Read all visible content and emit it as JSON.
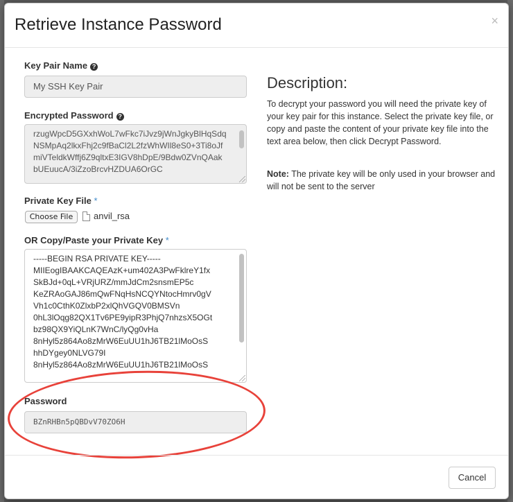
{
  "modal": {
    "title": "Retrieve Instance Password",
    "close_glyph": "×"
  },
  "form": {
    "key_pair_name": {
      "label": "Key Pair Name",
      "help_icon": "?",
      "value": "My SSH Key Pair"
    },
    "encrypted_password": {
      "label": "Encrypted Password",
      "help_icon": "?",
      "value": "rzugWpcD5GXxhWoL7wFkc7iJvz9jWnJgkyBlHqSdqNSMpAq2lkxFhj2c9fBaCl2L2fzWhWIl8eS0+3Ti8oJfmiVTeldkWffj6Z9qltxE3IGV8hDpE/9Bdw0ZVnQAakbUEuucA/3iZzoBrcvHZDUA6OrGC"
    },
    "private_key_file": {
      "label": "Private Key File",
      "required_mark": "*",
      "button_label": "Choose File",
      "file_icon": "file-icon",
      "file_name": "anvil_rsa"
    },
    "private_key_paste": {
      "label": "OR Copy/Paste your Private Key",
      "required_mark": "*",
      "lines": [
        "-----BEGIN RSA PRIVATE KEY-----",
        "MIIEogIBAAKCAQEAzK+um402A3PwFklreY1fx",
        "SkBJd+0qL+VRjURZ/mmJdCm2snsmEP5c",
        "KeZRAoGAJ86mQwFNqHsNCQYNtocHmrv0gV",
        "Vh1c0CthK0ZlxbP2xlQhVGQV0BMSVn",
        "0hL3lOqg82QX1Tv6PE9yipR3PhjQ7nhzsX5OGt",
        "bz98QX9YiQLnK7WnC/lyQg0vHa",
        "8nHyl5z864Ao8zMrW6EuUU1hJ6TB21lMoOsS",
        "hhDYgey0NLVG79I",
        "8nHyl5z864Ao8zMrW6EuUU1hJ6TB21lMoOsS"
      ]
    },
    "password": {
      "label": "Password",
      "value": "BZnRHBn5pQBDvV70ZO6H"
    }
  },
  "description": {
    "title": "Description:",
    "text": "To decrypt your password you will need the private key of your key pair for this instance. Select the private key file, or copy and paste the content of your private key file into the text area below, then click Decrypt Password.",
    "note_label": "Note:",
    "note_text": " The private key will be only used in your browser and will not be sent to the server"
  },
  "footer": {
    "cancel_label": "Cancel"
  },
  "colors": {
    "annotation": "#e8423a",
    "required": "#428bca",
    "backdrop": "#5a5a5a"
  }
}
